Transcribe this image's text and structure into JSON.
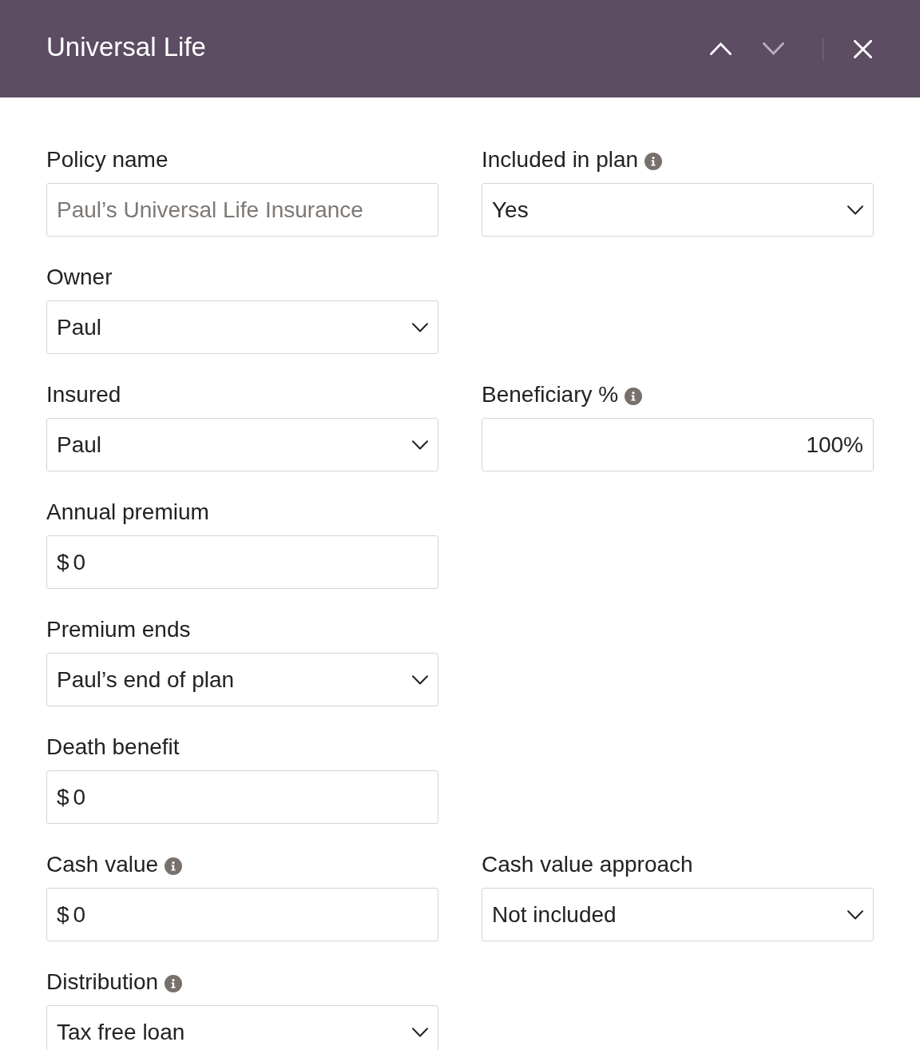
{
  "header": {
    "title": "Universal Life",
    "buttons": [
      {
        "kind": "previous",
        "disabled": false
      },
      {
        "kind": "next",
        "disabled": true
      },
      {
        "kind": "close",
        "disabled": false
      }
    ]
  },
  "rows": [
    {
      "fields": [
        {
          "label": "Policy name",
          "info": false,
          "kind": "text",
          "placeholder": "Paul’s Universal Life Insurance"
        },
        {
          "label": "Included in plan",
          "info": true,
          "kind": "select",
          "value": "Yes"
        }
      ]
    },
    {
      "fields": [
        {
          "label": "Owner",
          "info": false,
          "kind": "select",
          "value": "Paul"
        }
      ]
    },
    {
      "fields": [
        {
          "label": "Insured",
          "info": false,
          "kind": "select",
          "value": "Paul"
        },
        {
          "label": "Beneficiary %",
          "info": true,
          "kind": "number",
          "value": "100%"
        }
      ]
    },
    {
      "fields": [
        {
          "label": "Annual premium",
          "info": false,
          "kind": "currency",
          "prefix": "$",
          "value": "0"
        }
      ]
    },
    {
      "fields": [
        {
          "label": "Premium ends",
          "info": false,
          "kind": "select",
          "value": "Paul’s end of plan"
        }
      ]
    },
    {
      "fields": [
        {
          "label": "Death benefit",
          "info": false,
          "kind": "currency",
          "prefix": "$",
          "value": "0"
        }
      ]
    },
    {
      "fields": [
        {
          "label": "Cash value",
          "info": true,
          "kind": "currency",
          "prefix": "$",
          "value": "0"
        },
        {
          "label": "Cash value approach",
          "info": false,
          "kind": "select",
          "value": "Not included"
        }
      ]
    },
    {
      "fields": [
        {
          "label": "Distribution",
          "info": true,
          "kind": "select",
          "value": "Tax free loan"
        }
      ]
    }
  ]
}
